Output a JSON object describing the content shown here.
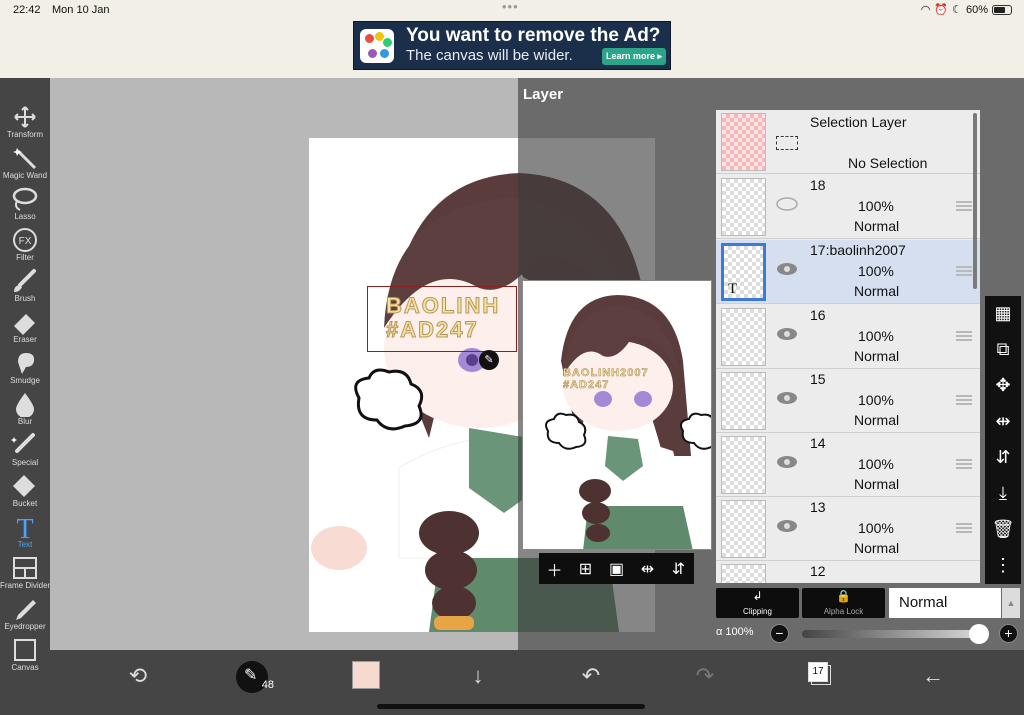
{
  "status": {
    "time": "22:42",
    "date": "Mon 10 Jan",
    "battery": "60%"
  },
  "ad": {
    "title": "You want to remove the Ad?",
    "subtitle": "The canvas will be wider.",
    "cta": "Learn more ▸"
  },
  "tools": [
    {
      "label": "Transform",
      "icon": "move-arrows-icon"
    },
    {
      "label": "Magic Wand",
      "icon": "magic-wand-icon"
    },
    {
      "label": "Lasso",
      "icon": "lasso-icon"
    },
    {
      "label": "Filter",
      "icon": "fx-icon"
    },
    {
      "label": "Brush",
      "icon": "brush-icon"
    },
    {
      "label": "Eraser",
      "icon": "eraser-icon"
    },
    {
      "label": "Smudge",
      "icon": "smudge-icon"
    },
    {
      "label": "Blur",
      "icon": "blur-drop-icon"
    },
    {
      "label": "Special",
      "icon": "special-pen-icon"
    },
    {
      "label": "Bucket",
      "icon": "bucket-icon"
    },
    {
      "label": "Text",
      "icon": "text-icon"
    },
    {
      "label": "Frame Divider",
      "icon": "frame-divider-icon"
    },
    {
      "label": "Eyedropper",
      "icon": "eyedropper-icon"
    },
    {
      "label": "Canvas",
      "icon": "canvas-icon"
    }
  ],
  "active_tool": "Text",
  "artwork_text": {
    "line1": "BAOLINH",
    "line2": "#AD247",
    "preview1": "BAOLINH2007",
    "preview2": "#AD247"
  },
  "layer_panel": {
    "title": "Layer",
    "selection_layer": {
      "name": "Selection Layer",
      "state": "No Selection"
    },
    "layers": [
      {
        "name": "18",
        "opacity": "100%",
        "blend": "Normal",
        "selected": false
      },
      {
        "name": "17:baolinh2007",
        "opacity": "100%",
        "blend": "Normal",
        "selected": true,
        "thumb_label": "T"
      },
      {
        "name": "16",
        "opacity": "100%",
        "blend": "Normal",
        "selected": false
      },
      {
        "name": "15",
        "opacity": "100%",
        "blend": "Normal",
        "selected": false
      },
      {
        "name": "14",
        "opacity": "100%",
        "blend": "Normal",
        "selected": false
      },
      {
        "name": "13",
        "opacity": "100%",
        "blend": "Normal",
        "selected": false
      },
      {
        "name": "12",
        "opacity": "",
        "blend": "",
        "selected": false
      }
    ],
    "clipping_label": "Clipping",
    "alpha_lock_label": "Alpha Lock",
    "blend_mode": "Normal",
    "alpha_label": "α 100%",
    "alpha_value": 1.0
  },
  "bottom": {
    "brush_size": "48",
    "color": "#f7dacf",
    "layer_count": "17"
  }
}
